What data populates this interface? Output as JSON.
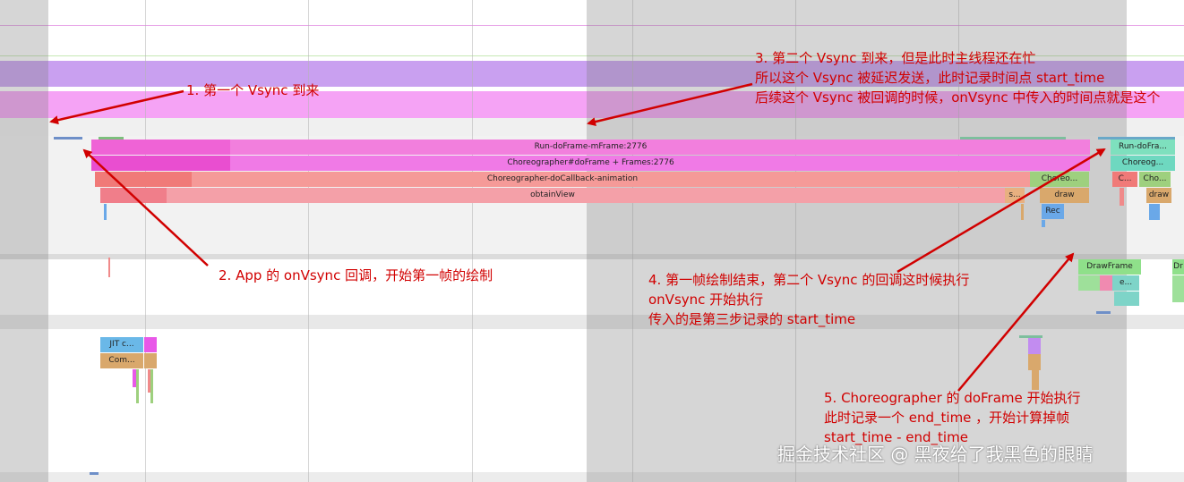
{
  "trace": {
    "slices": {
      "run_doframe": "Run-doFrame-mFrame:2776",
      "choreographer_doframe": "Choreographer#doFrame + Frames:2776",
      "do_callback_animation": "Choreographer-doCallback-animation",
      "obtain_view": "obtainView",
      "choreo_short": "Choreo...",
      "draw_right": "draw",
      "s_short": "s...",
      "rec": "Rec",
      "run_doframe_next": "Run-doFra...",
      "choreog_next": "Choreog...",
      "c_short": "C...",
      "cho_short": "Cho...",
      "draw_next": "draw",
      "drawframe": "DrawFrame",
      "e_short": "e...",
      "dr_short": "Dr",
      "jit": "JIT c...",
      "com": "Com..."
    }
  },
  "annotations": {
    "step1": [
      "1. 第一个 Vsync 到来"
    ],
    "step2": [
      "2. App 的 onVsync 回调，开始第一帧的绘制"
    ],
    "step3": [
      "3. 第二个 Vsync 到来，但是此时主线程还在忙",
      "所以这个 Vsync 被延迟发送，此时记录时间点 start_time",
      "后续这个 Vsync 被回调的时候，onVsync 中传入的时间点就是这个"
    ],
    "step4": [
      "4. 第一帧绘制结束，第二个 Vsync 的回调这时候执行",
      "onVsync 开始执行",
      "传入的是第三步记录的 start_time"
    ],
    "step5": [
      "5. Choreographer 的 doFrame 开始执行",
      "此时记录一个 end_time ，开始计算掉帧",
      "start_time - end_time"
    ]
  },
  "watermark": "掘金技术社区 @ 黑夜给了我黑色的眼睛",
  "colors": {
    "annotation": "#d10000",
    "vsync_lane": "#c79af0",
    "vsync_lane2": "#f59af5",
    "main_slice": "#f06ad6",
    "doframe": "#ef6ce0",
    "animation": "#f28585",
    "obtain": "#f39aa0"
  }
}
